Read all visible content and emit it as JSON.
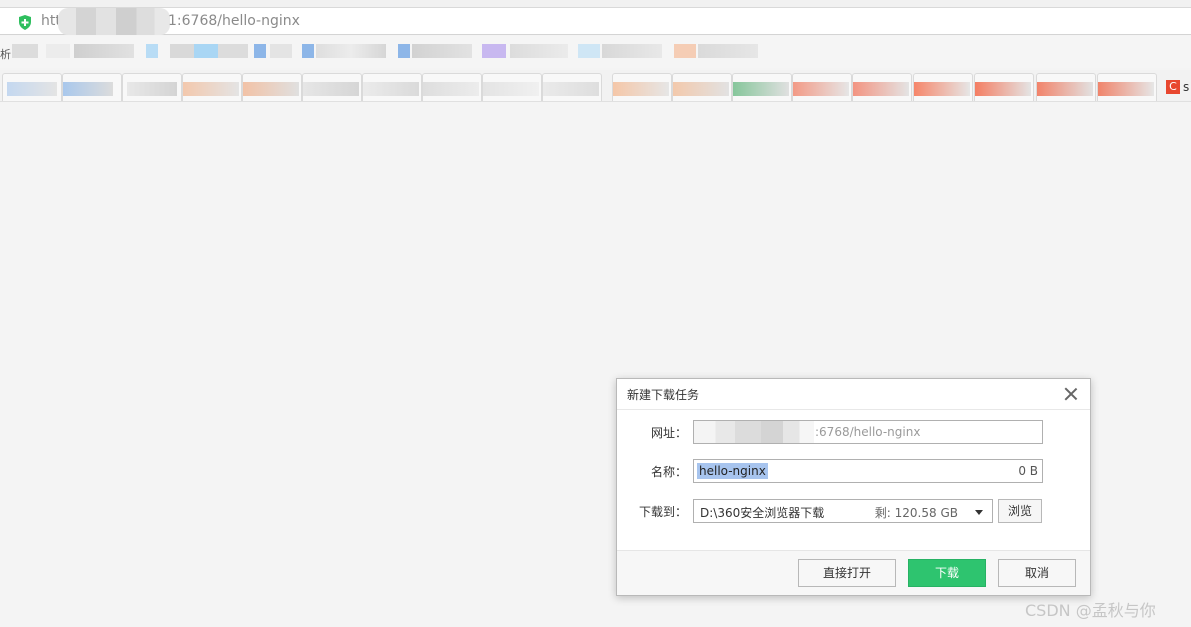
{
  "address_bar": {
    "url_prefix": "htt",
    "url_suffix": "1:6768/hello-nginx"
  },
  "bookmarks_bar": {
    "leading_glyph": "析"
  },
  "tab_strip": {
    "last_tab_icon": "C",
    "last_tab_text": "s"
  },
  "dialog": {
    "title": "新建下载任务",
    "url_label": "网址：",
    "url_value_tail": ":6768/hello-nginx",
    "name_label": "名称：",
    "name_value": "hello-nginx",
    "file_size": "0 B",
    "save_label": "下载到：",
    "save_path": "D:\\360安全浏览器下载",
    "free_space": "剩: 120.58 GB",
    "browse_label": "浏览",
    "open_label": "直接打开",
    "download_label": "下载",
    "cancel_label": "取消"
  },
  "colors": {
    "download_button": "#2ec46f",
    "selection": "#a7c4ee"
  },
  "watermark": "CSDN @孟秋与你"
}
